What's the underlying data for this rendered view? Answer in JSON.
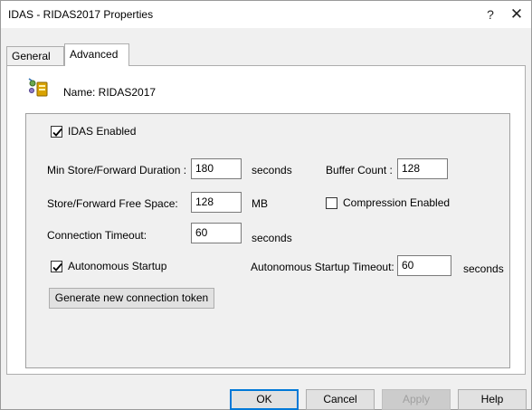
{
  "window": {
    "title": "IDAS - RIDAS2017 Properties",
    "help_glyph": "?",
    "close_glyph": "✕"
  },
  "tabs": [
    {
      "label": "General",
      "active": false
    },
    {
      "label": "Advanced",
      "active": true
    }
  ],
  "header": {
    "icon": "database-config-icon",
    "name_label": "Name: RIDAS2017"
  },
  "settings": {
    "idas_enabled": {
      "label": "IDAS Enabled",
      "checked": true
    },
    "min_store_forward": {
      "label": "Min Store/Forward Duration :",
      "value": "180",
      "unit": "seconds"
    },
    "buffer_count": {
      "label": "Buffer Count :",
      "value": "128"
    },
    "store_forward_space": {
      "label": "Store/Forward Free Space:",
      "value": "128",
      "unit": "MB"
    },
    "compression_enabled": {
      "label": "Compression Enabled",
      "checked": false
    },
    "connection_timeout": {
      "label": "Connection Timeout:",
      "value": "60",
      "unit": "seconds"
    },
    "autonomous_startup": {
      "label": "Autonomous Startup",
      "checked": true
    },
    "autonomous_timeout": {
      "label": "Autonomous Startup Timeout:",
      "value": "60",
      "unit": "seconds"
    },
    "generate_token_label": "Generate new connection token"
  },
  "footer": {
    "ok_label": "OK",
    "cancel_label": "Cancel",
    "apply_label": "Apply",
    "help_label": "Help"
  },
  "colors": {
    "accent": "#0078d7",
    "window_bg": "#f0f0f0",
    "panel_bg": "#ffffff"
  }
}
